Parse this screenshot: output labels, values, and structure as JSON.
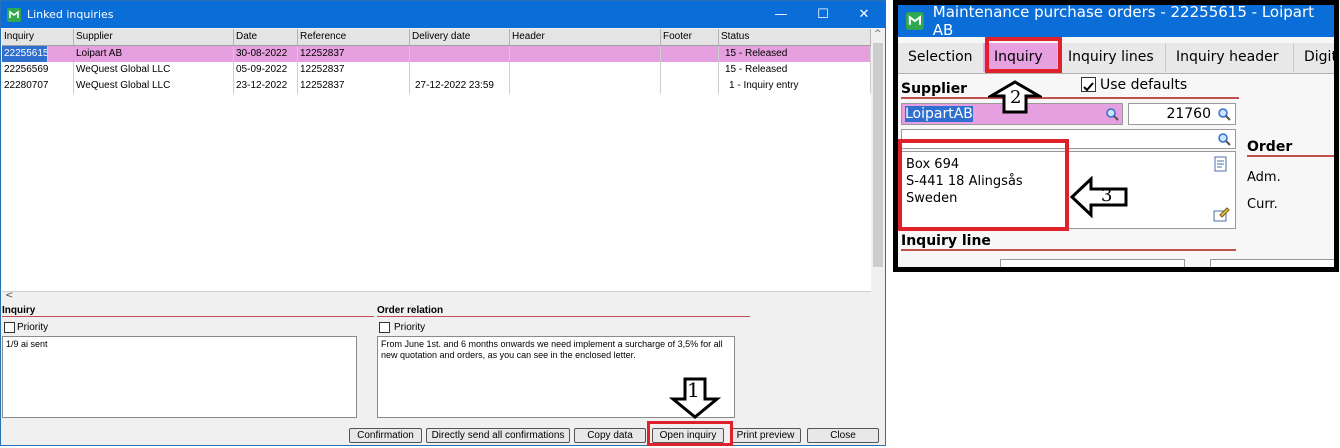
{
  "left_window": {
    "title": "Linked inquiries",
    "title_controls": [
      "—",
      "☐",
      "✕"
    ],
    "columns": [
      "Inquiry",
      "Supplier",
      "Date",
      "Reference",
      "Delivery date",
      "Header",
      "Footer",
      "Status"
    ],
    "rows": [
      [
        "22255615",
        "Loipart AB",
        "30-08-2022",
        "12252837",
        "",
        "",
        "",
        "15 - Released"
      ],
      [
        "22256569",
        "WeQuest Global LLC",
        "05-09-2022",
        "12252837",
        "",
        "",
        "",
        "15 - Released"
      ],
      [
        "22280707",
        "WeQuest Global LLC",
        "23-12-2022",
        "12252837",
        "27-12-2022 23:59",
        "",
        "",
        "1 - Inquiry entry"
      ]
    ],
    "scroll_left_glyph": "<",
    "scroll_up_glyph": "^",
    "inquiry_section": {
      "title": "Inquiry",
      "priority_label": "Priority",
      "note": "1/9 ai sent"
    },
    "order_relation": {
      "title": "Order relation",
      "priority_label": "Priority",
      "note": "From June 1st. and 6 months onwards we need implement a surcharge of 3,5% for all new quotation and orders, as you can see in the enclosed letter."
    },
    "buttons": {
      "confirmation": "Confirmation",
      "send_all": "Directly send all confirmations",
      "copy": "Copy data",
      "open": "Open inquiry",
      "print": "Print preview",
      "close": "Close"
    },
    "annotation_1": "1"
  },
  "right_window": {
    "title": "Maintenance purchase orders - 22255615 - Loipart AB",
    "tabs": [
      "Selection",
      "Inquiry",
      "Inquiry lines",
      "Inquiry header",
      "Digit"
    ],
    "supplier_label": "Supplier",
    "use_defaults_label": "Use defaults",
    "supplier_name": "LoipartAB",
    "supplier_number": "21760",
    "address_lines": [
      "Box 694",
      "S-441 18  Alingsås",
      "Sweden"
    ],
    "order_label": "Order",
    "adm_label": "Adm.",
    "curr_label": "Curr.",
    "inquiry_line_label": "Inquiry line",
    "annotation_2": "2",
    "annotation_3": "3"
  },
  "colors": {
    "titlebar": "#0b6ed8",
    "selection": "#e6a0e0",
    "highlight": "#2f6fd0",
    "annotation": "#e0202a",
    "section_rule": "#c0504d"
  }
}
